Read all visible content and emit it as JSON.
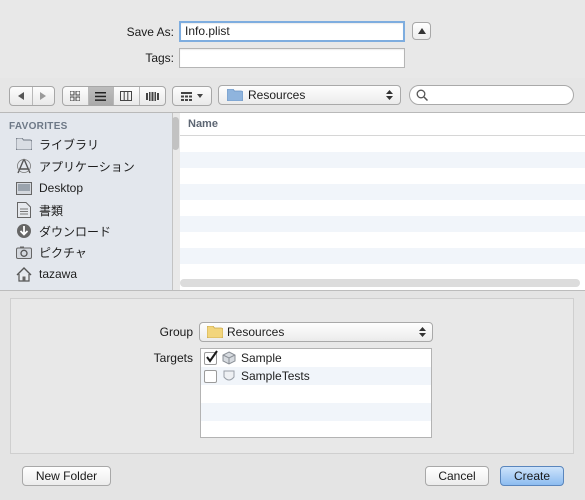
{
  "save_as": {
    "label": "Save As:",
    "value": "Info.plist"
  },
  "tags": {
    "label": "Tags:",
    "value": ""
  },
  "toolbar": {
    "location": "Resources",
    "search_placeholder": ""
  },
  "sidebar": {
    "heading": "FAVORITES",
    "items": [
      {
        "label": "ライブラリ",
        "icon": "folder-icon"
      },
      {
        "label": "アプリケーション",
        "icon": "applications-icon"
      },
      {
        "label": "Desktop",
        "icon": "desktop-icon"
      },
      {
        "label": "書類",
        "icon": "documents-icon"
      },
      {
        "label": "ダウンロード",
        "icon": "downloads-icon"
      },
      {
        "label": "ピクチャ",
        "icon": "pictures-icon"
      },
      {
        "label": "tazawa",
        "icon": "home-icon"
      }
    ]
  },
  "file_list": {
    "column_name": "Name"
  },
  "options": {
    "group_label": "Group",
    "group_value": "Resources",
    "targets_label": "Targets",
    "targets": [
      {
        "name": "Sample",
        "checked": true
      },
      {
        "name": "SampleTests",
        "checked": false
      }
    ]
  },
  "buttons": {
    "new_folder": "New Folder",
    "cancel": "Cancel",
    "create": "Create"
  },
  "colors": {
    "accent": "#5a9ae6",
    "sidebar_bg": "#e3e7ed",
    "stripe": "#f1f5fa"
  }
}
